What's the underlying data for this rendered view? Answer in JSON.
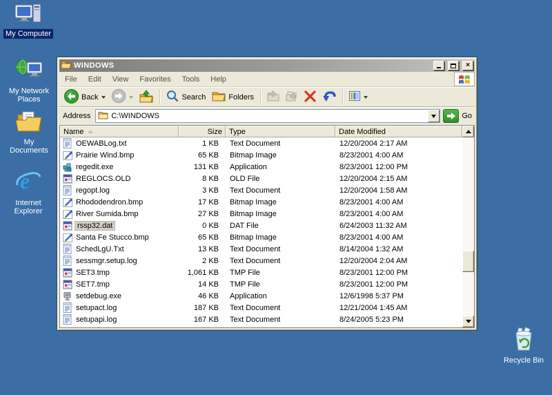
{
  "desktop": {
    "background_color": "#3A6EA5",
    "selection_color": "#0A246A",
    "icons": [
      {
        "id": "my-computer",
        "label": "My Computer",
        "selected": true
      },
      {
        "id": "my-network-places",
        "label": "My Network Places",
        "selected": false
      },
      {
        "id": "my-documents",
        "label": "My Documents",
        "selected": false
      },
      {
        "id": "internet-explorer",
        "label": "Internet Explorer",
        "selected": false
      },
      {
        "id": "recycle-bin",
        "label": "Recycle Bin",
        "selected": false
      }
    ]
  },
  "window": {
    "title": "WINDOWS",
    "menu": [
      "File",
      "Edit",
      "View",
      "Favorites",
      "Tools",
      "Help"
    ],
    "toolbar": {
      "back_label": "Back",
      "search_label": "Search",
      "folders_label": "Folders"
    },
    "address": {
      "label": "Address",
      "value": "C:\\WINDOWS",
      "go_label": "Go"
    },
    "columns": [
      "Name",
      "Size",
      "Type",
      "Date Modified"
    ],
    "files": [
      {
        "name": "OEWABLog.txt",
        "size": "1 KB",
        "type": "Text Document",
        "date": "12/20/2004 2:17 AM",
        "icon": "text",
        "selected": false
      },
      {
        "name": "Prairie Wind.bmp",
        "size": "65 KB",
        "type": "Bitmap Image",
        "date": "8/23/2001 4:00 AM",
        "icon": "bitmap",
        "selected": false
      },
      {
        "name": "regedit.exe",
        "size": "131 KB",
        "type": "Application",
        "date": "8/23/2001 12:00 PM",
        "icon": "regedit",
        "selected": false
      },
      {
        "name": "REGLOCS.OLD",
        "size": "8 KB",
        "type": "OLD File",
        "date": "12/20/2004 2:15 AM",
        "icon": "generic",
        "selected": false
      },
      {
        "name": "regopt.log",
        "size": "3 KB",
        "type": "Text Document",
        "date": "12/20/2004 1:58 AM",
        "icon": "text",
        "selected": false
      },
      {
        "name": "Rhododendron.bmp",
        "size": "17 KB",
        "type": "Bitmap Image",
        "date": "8/23/2001 4:00 AM",
        "icon": "bitmap",
        "selected": false
      },
      {
        "name": "River Sumida.bmp",
        "size": "27 KB",
        "type": "Bitmap Image",
        "date": "8/23/2001 4:00 AM",
        "icon": "bitmap",
        "selected": false
      },
      {
        "name": "rssp32.dat",
        "size": "0 KB",
        "type": "DAT File",
        "date": "6/24/2003 11:32 AM",
        "icon": "generic",
        "selected": true
      },
      {
        "name": "Santa Fe Stucco.bmp",
        "size": "65 KB",
        "type": "Bitmap Image",
        "date": "8/23/2001 4:00 AM",
        "icon": "bitmap",
        "selected": false
      },
      {
        "name": "SchedLgU.Txt",
        "size": "13 KB",
        "type": "Text Document",
        "date": "8/14/2004 1:32 AM",
        "icon": "text",
        "selected": false
      },
      {
        "name": "sessmgr.setup.log",
        "size": "2 KB",
        "type": "Text Document",
        "date": "12/20/2004 2:04 AM",
        "icon": "text",
        "selected": false
      },
      {
        "name": "SET3.tmp",
        "size": "1,061 KB",
        "type": "TMP File",
        "date": "8/23/2001 12:00 PM",
        "icon": "generic",
        "selected": false
      },
      {
        "name": "SET7.tmp",
        "size": "14 KB",
        "type": "TMP File",
        "date": "8/23/2001 12:00 PM",
        "icon": "generic",
        "selected": false
      },
      {
        "name": "setdebug.exe",
        "size": "46 KB",
        "type": "Application",
        "date": "12/6/1998 5:37 PM",
        "icon": "app",
        "selected": false
      },
      {
        "name": "setupact.log",
        "size": "187 KB",
        "type": "Text Document",
        "date": "12/21/2004 1:45 AM",
        "icon": "text",
        "selected": false
      },
      {
        "name": "setupapi.log",
        "size": "167 KB",
        "type": "Text Document",
        "date": "8/24/2005 5:23 PM",
        "icon": "text",
        "selected": false
      }
    ]
  }
}
